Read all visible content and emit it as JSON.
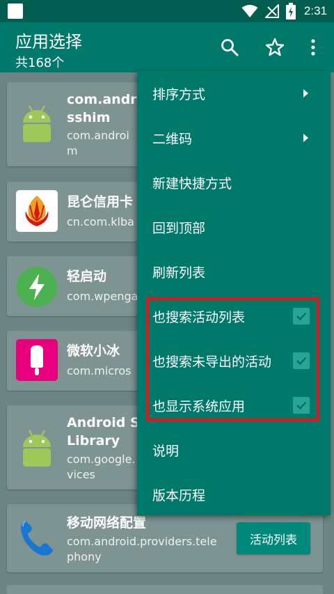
{
  "status_bar": {
    "time": "2:31"
  },
  "app_bar": {
    "title": "应用选择",
    "subtitle": "共168个"
  },
  "list": [
    {
      "name": "com.andro",
      "name2": "sshim",
      "package": "com.androi",
      "package2": "m",
      "icon": "android-icon"
    },
    {
      "name": "昆仑信用卡",
      "package": "cn.com.klba",
      "icon": "kunlun-logo-icon"
    },
    {
      "name": "轻启动",
      "package": "com.wpenga",
      "icon": "lightning-icon"
    },
    {
      "name": "微软小冰",
      "package": "com.micros",
      "icon": "popsicle-icon"
    },
    {
      "name": "Android Se",
      "name2": "Library",
      "package": "com.google.",
      "package2": "vices",
      "icon": "android-icon"
    },
    {
      "name": "移动网络配置",
      "package": "com.android.providers.tele",
      "package2": "phony",
      "icon": "phone-icon",
      "button": "活动列表"
    }
  ],
  "menu": {
    "items": [
      {
        "label": "排序方式",
        "submenu": true
      },
      {
        "label": "二维码",
        "submenu": true
      },
      {
        "label": "新建快捷方式"
      },
      {
        "label": "回到顶部"
      },
      {
        "label": "刷新列表"
      },
      {
        "label": "也搜索活动列表",
        "checked": true
      },
      {
        "label": "也搜索未导出的活动",
        "checked": true
      },
      {
        "label": "也显示系统应用",
        "checked": true
      },
      {
        "label": "说明"
      },
      {
        "label": "版本历程"
      }
    ]
  },
  "colors": {
    "primary": "#00796b",
    "status_bar": "#005d4f",
    "accent": "#26a69a",
    "highlight": "#e8121e"
  }
}
